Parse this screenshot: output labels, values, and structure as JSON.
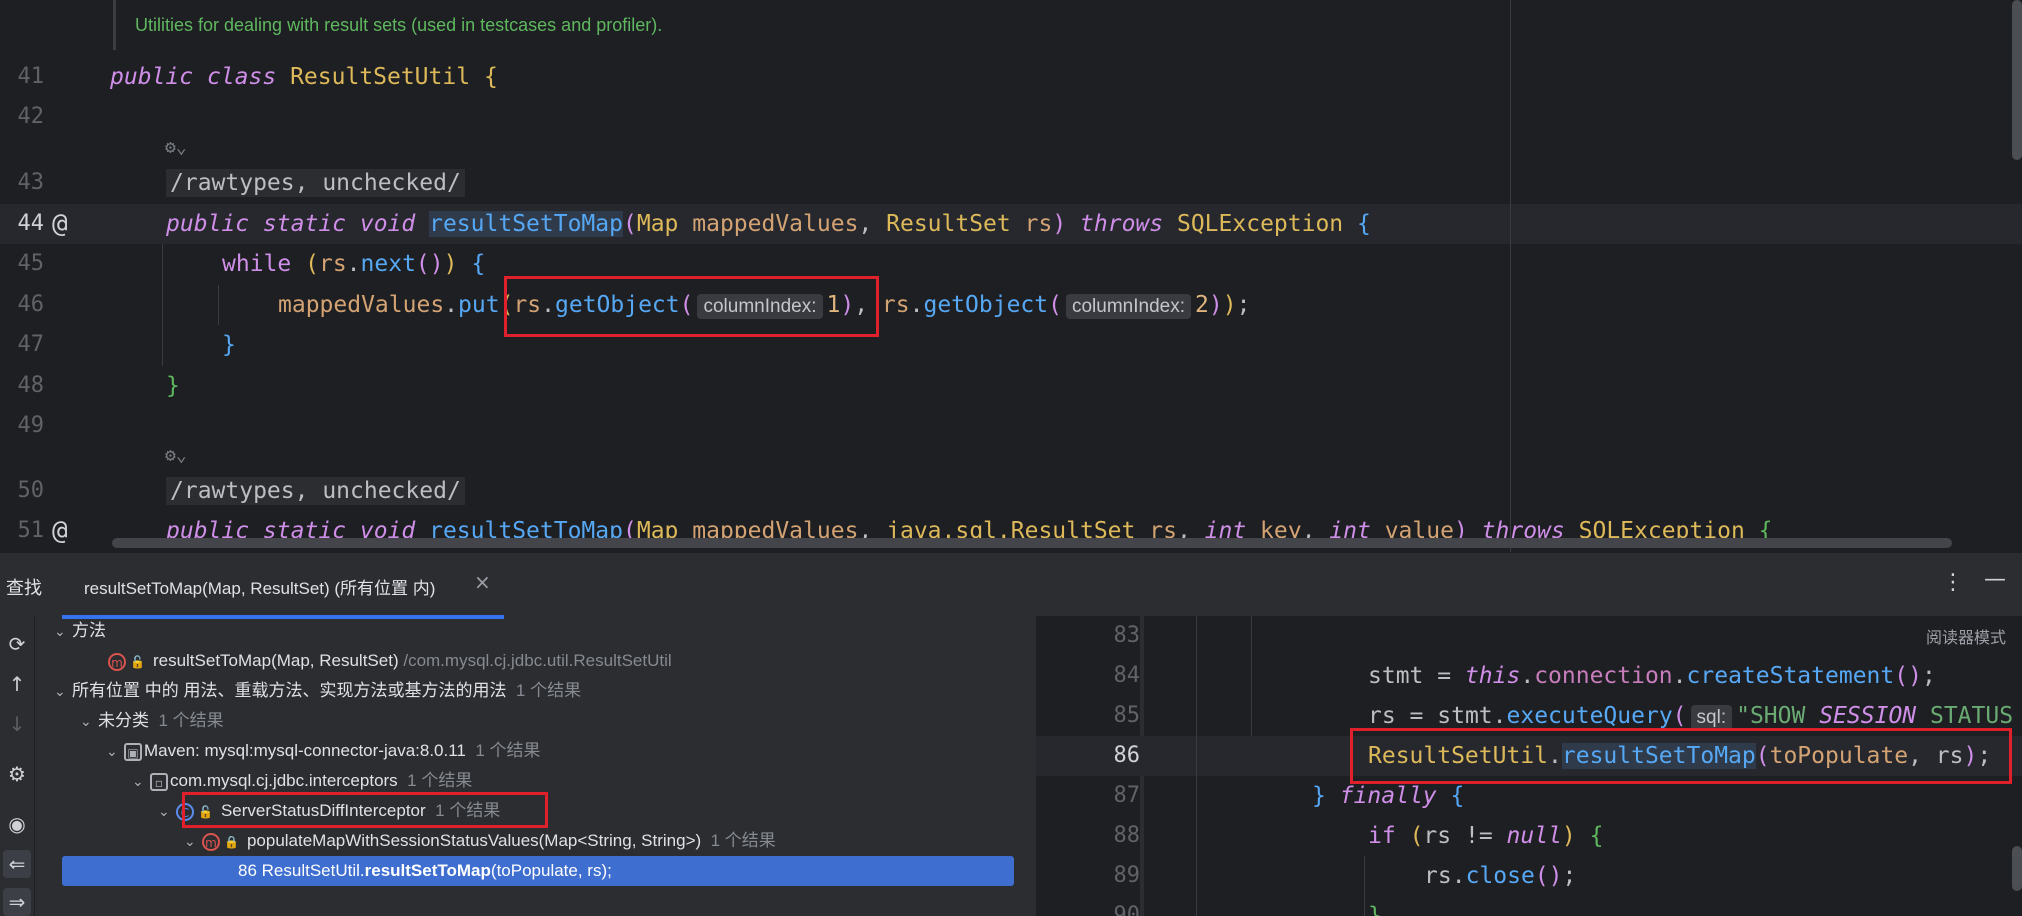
{
  "editor": {
    "doc_comment": "Utilities for dealing with result sets (used in testcases and profiler).",
    "line_numbers": [
      "41",
      "42",
      "43",
      "44",
      "45",
      "46",
      "47",
      "48",
      "49",
      "50",
      "51"
    ],
    "annotation_text": "/rawtypes, unchecked/",
    "class_decl": {
      "kw1": "public",
      "kw2": "class",
      "name": "ResultSetUtil",
      "brace": "{"
    },
    "method1": {
      "mods": "public static void",
      "name": "resultSetToMap",
      "p1_type": "Map",
      "p1_name": "mappedValues",
      "p2_type": "ResultSet",
      "p2_name": "rs",
      "throws": "throws",
      "exception": "SQLException"
    },
    "while_kw": "while",
    "rs": "rs",
    "next_call": "next",
    "mappedValues": "mappedValues",
    "put_call": "put",
    "getObject": "getObject",
    "hint_label": "columnIndex:",
    "arg1": "1",
    "arg2": "2",
    "method2": {
      "mods": "public static void",
      "name": "resultSetToMap",
      "p1_type": "Map",
      "p1_name": "mappedValues",
      "p2_type": "java.sql.ResultSet",
      "p2_name": "rs",
      "int_kw": "int",
      "p3_name": "key",
      "p4_name": "value",
      "throws": "throws",
      "exception": "SQLException"
    }
  },
  "find_panel": {
    "title": "查找",
    "tab_label": "resultSetToMap(Map, ResultSet) (所有位置 内)",
    "close_glyph": "×",
    "more_glyph": "⋮",
    "minimize_glyph": "—",
    "tree": {
      "methods_header": "方法",
      "method_item": "resultSetToMap(Map, ResultSet)",
      "method_path": "/com.mysql.cj.jdbc.util.ResultSetUtil",
      "usages_header": "所有位置 中的 用法、重载方法、实现方法或基方法的用法",
      "usages_count": "1 个结果",
      "uncategorized": "未分类",
      "uncategorized_count": "1 个结果",
      "maven_lib": "Maven: mysql:mysql-connector-java:8.0.11",
      "maven_count": "1 个结果",
      "package": "com.mysql.cj.jdbc.interceptors",
      "package_count": "1 个结果",
      "class_name": "ServerStatusDiffInterceptor",
      "class_count": "1 个结果",
      "method_name": "populateMapWithSessionStatusValues(Map<String, String>)",
      "method_count": "1 个结果",
      "usage_line_no": "86",
      "usage_prefix": "ResultSetUtil.",
      "usage_method": "resultSetToMap",
      "usage_suffix": "(toPopulate, rs);"
    },
    "preview": {
      "reader_mode": "阅读器模式",
      "line_numbers": [
        "83",
        "84",
        "85",
        "86",
        "87",
        "88",
        "89",
        "90"
      ],
      "stmt": "stmt",
      "this_kw": "this",
      "connection": "connection",
      "createStatement": "createStatement",
      "rs": "rs",
      "executeQuery": "executeQuery",
      "sql_hint": "sql:",
      "show_str1": "\"SHOW ",
      "show_str2": "SESSION",
      "show_str3": " STATUS",
      "util_class": "ResultSetUtil",
      "util_method": "resultSetToMap",
      "to_populate": "toPopulate",
      "finally_kw": "finally",
      "if_kw": "if",
      "null_kw": "null",
      "close_call": "close"
    }
  },
  "icons": [
    "refresh-icon",
    "up-arrow-icon",
    "down-arrow-icon",
    "settings-icon",
    "eye-icon",
    "navigate-icon",
    "export-icon",
    "class-icon",
    "method-icon",
    "folder-icon",
    "lock-icon",
    "settings-fold-icon"
  ]
}
